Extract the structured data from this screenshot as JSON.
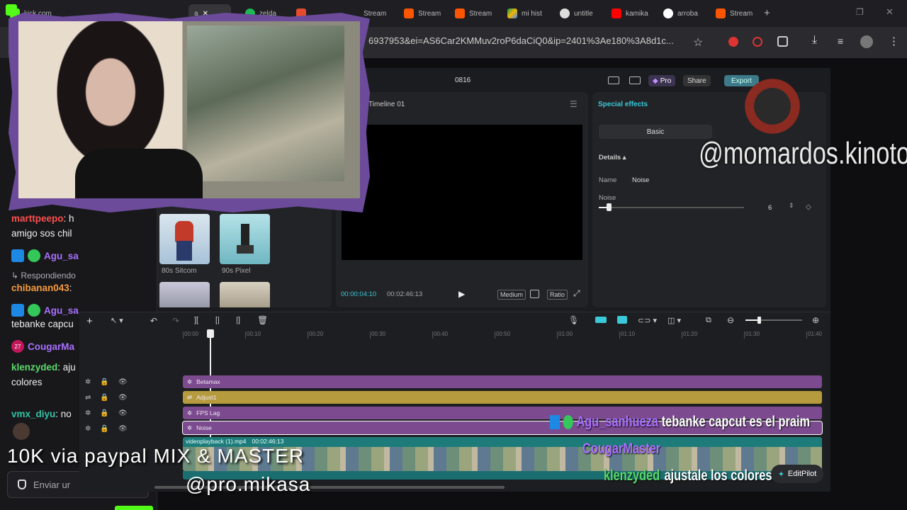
{
  "browser": {
    "tabs": [
      "kick.com",
      "a",
      "zelda",
      "",
      "Stream",
      "Stream",
      "Stream",
      "mi hist",
      "untitle",
      "kamika",
      "arroba",
      "Stream"
    ],
    "url": "6937953&ei=AS6Car2KMMuv2roP6daCiQ0&ip=2401%3Ae180%3A8d1c..."
  },
  "chat": {
    "lines": [
      {
        "user": "marttpeepo",
        "text": ": h",
        "color": "#ff4f4f"
      },
      {
        "user": "",
        "text": "amigo sos chil",
        "color": "#efeff1"
      },
      {
        "user": "Agu_sa",
        "text": "",
        "color": "#a970ff"
      },
      {
        "user": "",
        "text": "Respondiendo",
        "color": "#adadb8"
      },
      {
        "user": "chibanan043",
        "text": ":",
        "color": "#f59b3c"
      },
      {
        "user": "Agu_sa",
        "text": "",
        "color": "#a970ff"
      },
      {
        "user": "",
        "text": "tebanke capcu",
        "color": "#efeff1"
      },
      {
        "user": "CougarMa",
        "text": "",
        "color": "#a970ff"
      },
      {
        "user": "klenzyded",
        "text": ": aju",
        "color": "#5bd96b"
      },
      {
        "user": "",
        "text": "colores",
        "color": "#efeff1"
      },
      {
        "user": "vmx_diyu",
        "text": ": no",
        "color": "#32c3a6"
      }
    ],
    "badge_count": "27",
    "input_placeholder": "Enviar ur"
  },
  "capcut": {
    "title": "0816",
    "pro_label": "Pro",
    "share_label": "Share",
    "export_label": "Export",
    "player_title": "Timeline 01",
    "time_current": "00:00:04:10",
    "time_total": "00:02:46:13",
    "quality_label": "Medium",
    "ratio_label": "Ratio",
    "effects": [
      {
        "label": "80s Sitcom"
      },
      {
        "label": "90s Pixel"
      }
    ],
    "inspector": {
      "tab": "Special effects",
      "basic_label": "Basic",
      "details_label": "Details",
      "name_label": "Name",
      "name_value": "Noise",
      "noise_label": "Noise",
      "noise_value": "6"
    },
    "ruler": [
      "00:00",
      "00:10",
      "00:20",
      "00:30",
      "00:40",
      "00:50",
      "01:00",
      "01:10",
      "01:20",
      "01:30",
      "01:40"
    ],
    "tracks": [
      {
        "label": "Betamax",
        "color": "#7b4a8f"
      },
      {
        "label": "Adjust1",
        "color": "#b69b3e"
      },
      {
        "label": "FPS Lag",
        "color": "#7b4a8f"
      },
      {
        "label": "Noise",
        "color": "#7b4a8f"
      }
    ],
    "clip_label": "videoplayback (1).mp4",
    "clip_duration": "00:02:46:13",
    "editpilot_label": "EditPilot"
  },
  "overlay": {
    "watermark": "@momardos.kinoto",
    "promo_line": "10K via paypal MIX & MASTER",
    "promo_handle": "@pro.mikasa",
    "chat_overlay": [
      {
        "user": "Agu_sanhueza",
        "text": "tebanke capcut es el praim",
        "color": "#a970ff"
      },
      {
        "user": "CougarMaster",
        "text": "",
        "color": "#a970ff"
      },
      {
        "user": "klenzyded",
        "text": "ajustale los colores",
        "color": "#5bd96b"
      }
    ]
  }
}
